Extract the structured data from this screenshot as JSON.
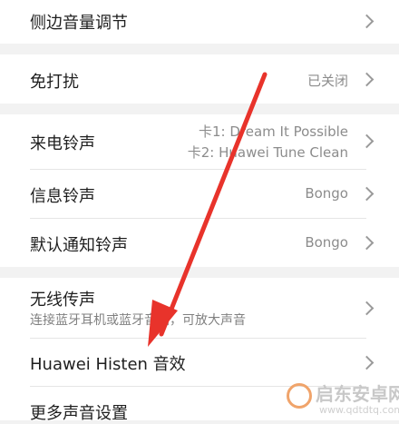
{
  "settings": {
    "side_volume": {
      "title": "侧边音量调节"
    },
    "dnd": {
      "title": "免打扰",
      "value": "已关闭"
    },
    "ringtone": {
      "title": "来电铃声",
      "value_line1": "卡1: Dream It Possible",
      "value_line2": "卡2: Huawei Tune Clean"
    },
    "message_tone": {
      "title": "信息铃声",
      "value": "Bongo"
    },
    "notification_tone": {
      "title": "默认通知铃声",
      "value": "Bongo"
    },
    "wireless": {
      "title": "无线传声",
      "subtitle": "连接蓝牙耳机或蓝牙音箱，可放大声音"
    },
    "histen": {
      "title": "Huawei Histen 音效"
    },
    "more_sound": {
      "title": "更多声音设置"
    }
  },
  "annotation": {
    "arrow_color": "#e8332b"
  },
  "watermark": {
    "name": "启东安卓网",
    "url": "www.qdtdtq.com"
  },
  "colors": {
    "background": "#f2f2f2",
    "card": "#ffffff",
    "secondary_text": "#8c8c8c"
  }
}
